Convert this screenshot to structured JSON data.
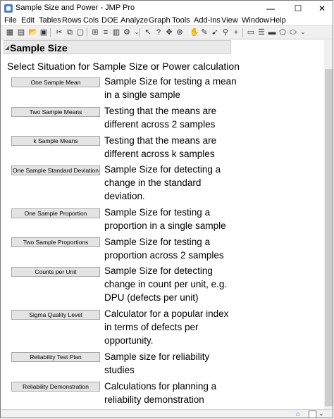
{
  "window": {
    "title": "Sample Size and Power - JMP Pro",
    "minimize_glyph": "—",
    "maximize_glyph": "☐",
    "close_glyph": "✕"
  },
  "menu": [
    "File",
    "Edit",
    "Tables",
    "Rows",
    "Cols",
    "DOE",
    "Analyze",
    "Graph",
    "Tools",
    "Add-Ins",
    "View",
    "Window",
    "Help"
  ],
  "toolbar_icons": [
    "new-table-icon",
    "open-icon",
    "open-folder-icon",
    "save-icon",
    "script-icon",
    "cut-icon",
    "copy-icon",
    "paste-icon",
    "data-grid-icon",
    "settings-icon",
    "arrow-select-icon",
    "help-question-icon",
    "brush-icon",
    "crosshair-icon",
    "hand-icon",
    "lasso-icon",
    "magnifier-icon",
    "zoom-icon",
    "plus-icon",
    "annotate-icon",
    "line-tool-icon",
    "rectangle-icon",
    "polygon-icon",
    "ellipse-icon"
  ],
  "outline": {
    "title": "Sample Size",
    "subtitle": "Select Situation for Sample Size or Power calculation"
  },
  "options": [
    {
      "button": "One Sample Mean",
      "description": "Sample Size for testing a mean in a single sample"
    },
    {
      "button": "Two Sample Means",
      "description": "Testing that the means are different across 2 samples"
    },
    {
      "button": "k Sample Means",
      "description": "Testing that the means are different across k samples"
    },
    {
      "button": "One Sample Standard Deviation",
      "description": "Sample Size for detecting a change in the standard deviation."
    },
    {
      "button": "One Sample Proportion",
      "description": "Sample Size for testing a proportion in a single sample"
    },
    {
      "button": "Two Sample Proportions",
      "description": "Sample Size for testing a proportion across 2 samples"
    },
    {
      "button": "Counts per Unit",
      "description": "Sample Size for detecting change in count per unit, e.g. DPU (defects per unit)"
    },
    {
      "button": "Sigma Quality Level",
      "description": "Calculator for a popular index in terms of defects per opportunity."
    },
    {
      "button": "Reliability Test Plan",
      "description": "Sample size for reliability studies"
    },
    {
      "button": "Reliability Demonstration",
      "description": "Calculations for planning a reliability demonstration"
    }
  ]
}
